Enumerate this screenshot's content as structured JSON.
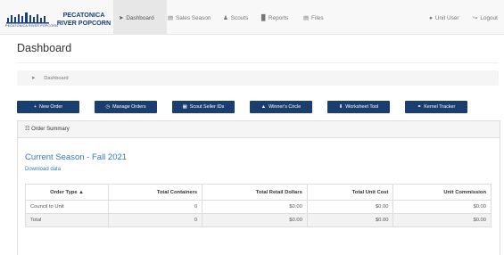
{
  "brand": {
    "name": "PECATONICA RIVER POPCORN",
    "sub": "PECATONICA RIVER POPCORN"
  },
  "nav": {
    "dashboard": "Dashboard",
    "sales_season": "Sales Season",
    "scouts": "Scouts",
    "reports": "Reports",
    "files": "Files",
    "user": "Unit User",
    "logout": "Logout"
  },
  "page": {
    "title": "Dashboard",
    "breadcrumb": "Dashboard"
  },
  "buttons": {
    "new_order": "New Order",
    "manage_orders": "Manage Orders",
    "scout_seller_ids": "Scout Seller IDs",
    "winners_circle": "Winner's Circle",
    "worksheet_tool": "Worksheet Tool",
    "kernel_tracker": "Kernel Tracker"
  },
  "panel": {
    "heading": "Order Summary"
  },
  "season": {
    "title": "Current Season - Fall 2021",
    "download": "Download data"
  },
  "table": {
    "headers": [
      "Order Type ▲",
      "Total Containers",
      "Total Retail Dollars",
      "Total Unit Cost",
      "Unit Commission"
    ],
    "rows": [
      [
        "Council to Unit",
        "0",
        "$0.00",
        "$0.00",
        "$0.00"
      ]
    ],
    "total": [
      "Total",
      "0",
      "$0.00",
      "$0.00",
      "$0.00"
    ]
  },
  "icons": {
    "dashboard": "send-icon",
    "sales_season": "book-icon",
    "scouts": "users-icon",
    "reports": "bar-chart-icon",
    "files": "file-icon",
    "user": "user-icon",
    "logout": "logout-icon"
  }
}
